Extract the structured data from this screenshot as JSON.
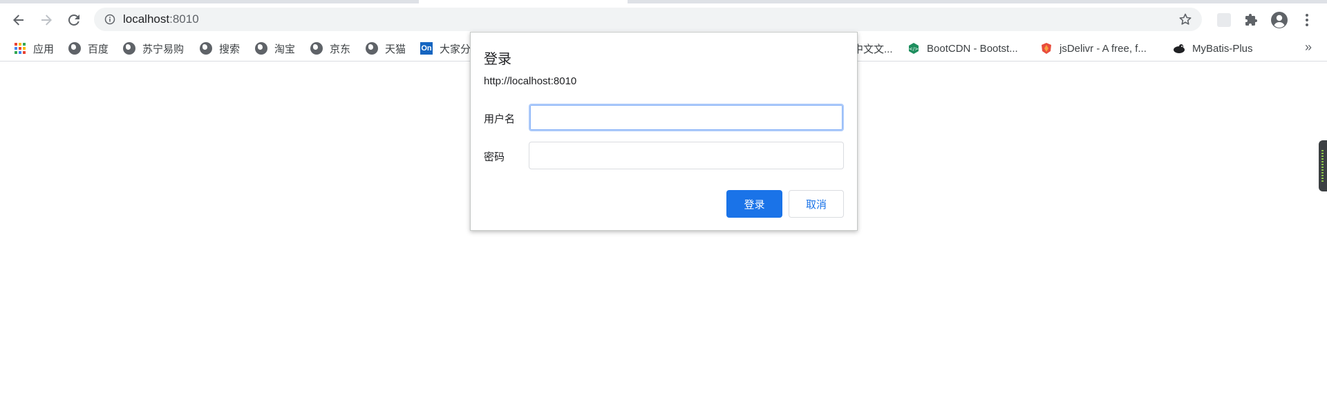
{
  "browser": {
    "url_host": "localhost",
    "url_port": ":8010",
    "icons": {
      "back": "back-arrow-icon",
      "forward": "forward-arrow-icon",
      "reload": "reload-icon",
      "site_info": "info-icon",
      "bookmark_star": "star-icon",
      "extension_blank": "extension-tile-icon",
      "extensions": "puzzle-icon",
      "profile": "account-icon",
      "menu": "kebab-menu-icon"
    }
  },
  "bookmarks": {
    "items": [
      {
        "label": "应用",
        "icon": "apps-grid-icon"
      },
      {
        "label": "百度",
        "icon": "globe-icon"
      },
      {
        "label": "苏宁易购",
        "icon": "globe-icon"
      },
      {
        "label": "搜索",
        "icon": "globe-icon"
      },
      {
        "label": "淘宝",
        "icon": "globe-icon"
      },
      {
        "label": "京东",
        "icon": "globe-icon"
      },
      {
        "label": "天猫",
        "icon": "globe-icon"
      },
      {
        "label": "大家分",
        "icon": "on-icon"
      },
      {
        "label": "中文文...",
        "icon": "globe-icon"
      },
      {
        "label": "BootCDN - Bootst...",
        "icon": "bootcdn-icon"
      },
      {
        "label": "jsDelivr - A free, f...",
        "icon": "jsdelivr-icon"
      },
      {
        "label": "MyBatis-Plus",
        "icon": "mybatis-icon"
      }
    ],
    "overflow_label": "»"
  },
  "dialog": {
    "title": "登录",
    "origin": "http://localhost:8010",
    "username_label": "用户名",
    "username_value": "",
    "password_label": "密码",
    "password_value": "",
    "login_button": "登录",
    "cancel_button": "取消"
  },
  "colors": {
    "accent": "#1a73e8",
    "omnibox_bg": "#f1f3f4",
    "focus_ring": "#8ab4f8"
  }
}
